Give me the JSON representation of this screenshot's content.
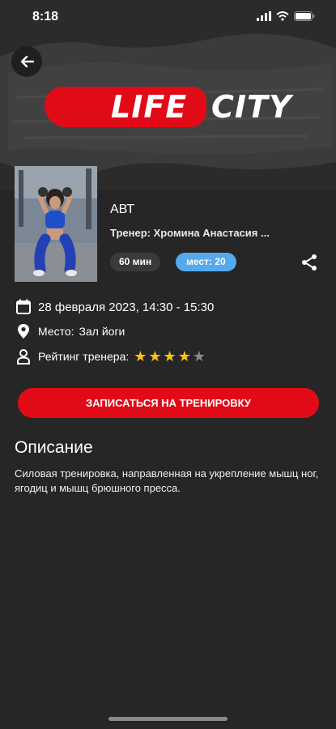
{
  "status_bar": {
    "time": "8:18"
  },
  "header": {
    "logo_left": "LIFE",
    "logo_right": "CITY"
  },
  "workout": {
    "title": "АВТ",
    "trainer": "Тренер: Хромина Анастасия ...",
    "duration": "60 мин",
    "slots": "мест: 20"
  },
  "details": {
    "date": "28 февраля 2023, 14:30 - 15:30",
    "place_label": "Место:",
    "place_value": "Зал йоги",
    "rating_label": "Рейтинг тренера:",
    "rating": 4,
    "rating_max": 5
  },
  "cta_label": "ЗАПИСАТЬСЯ НА ТРЕНИРОВКУ",
  "description": {
    "title": "Описание",
    "text": "Силовая тренировка, направленная на укрепление мышц ног, ягодиц и мышц брюшного пресса."
  },
  "colors": {
    "accent": "#e10b17",
    "slots_pill": "#56a9ef",
    "star_active": "#f5c518",
    "star_inactive": "#8a8a8a"
  },
  "icons": {
    "back": "back-arrow-icon",
    "share": "share-icon",
    "date": "calendar-icon",
    "place": "location-pin-icon",
    "rating": "person-icon"
  }
}
